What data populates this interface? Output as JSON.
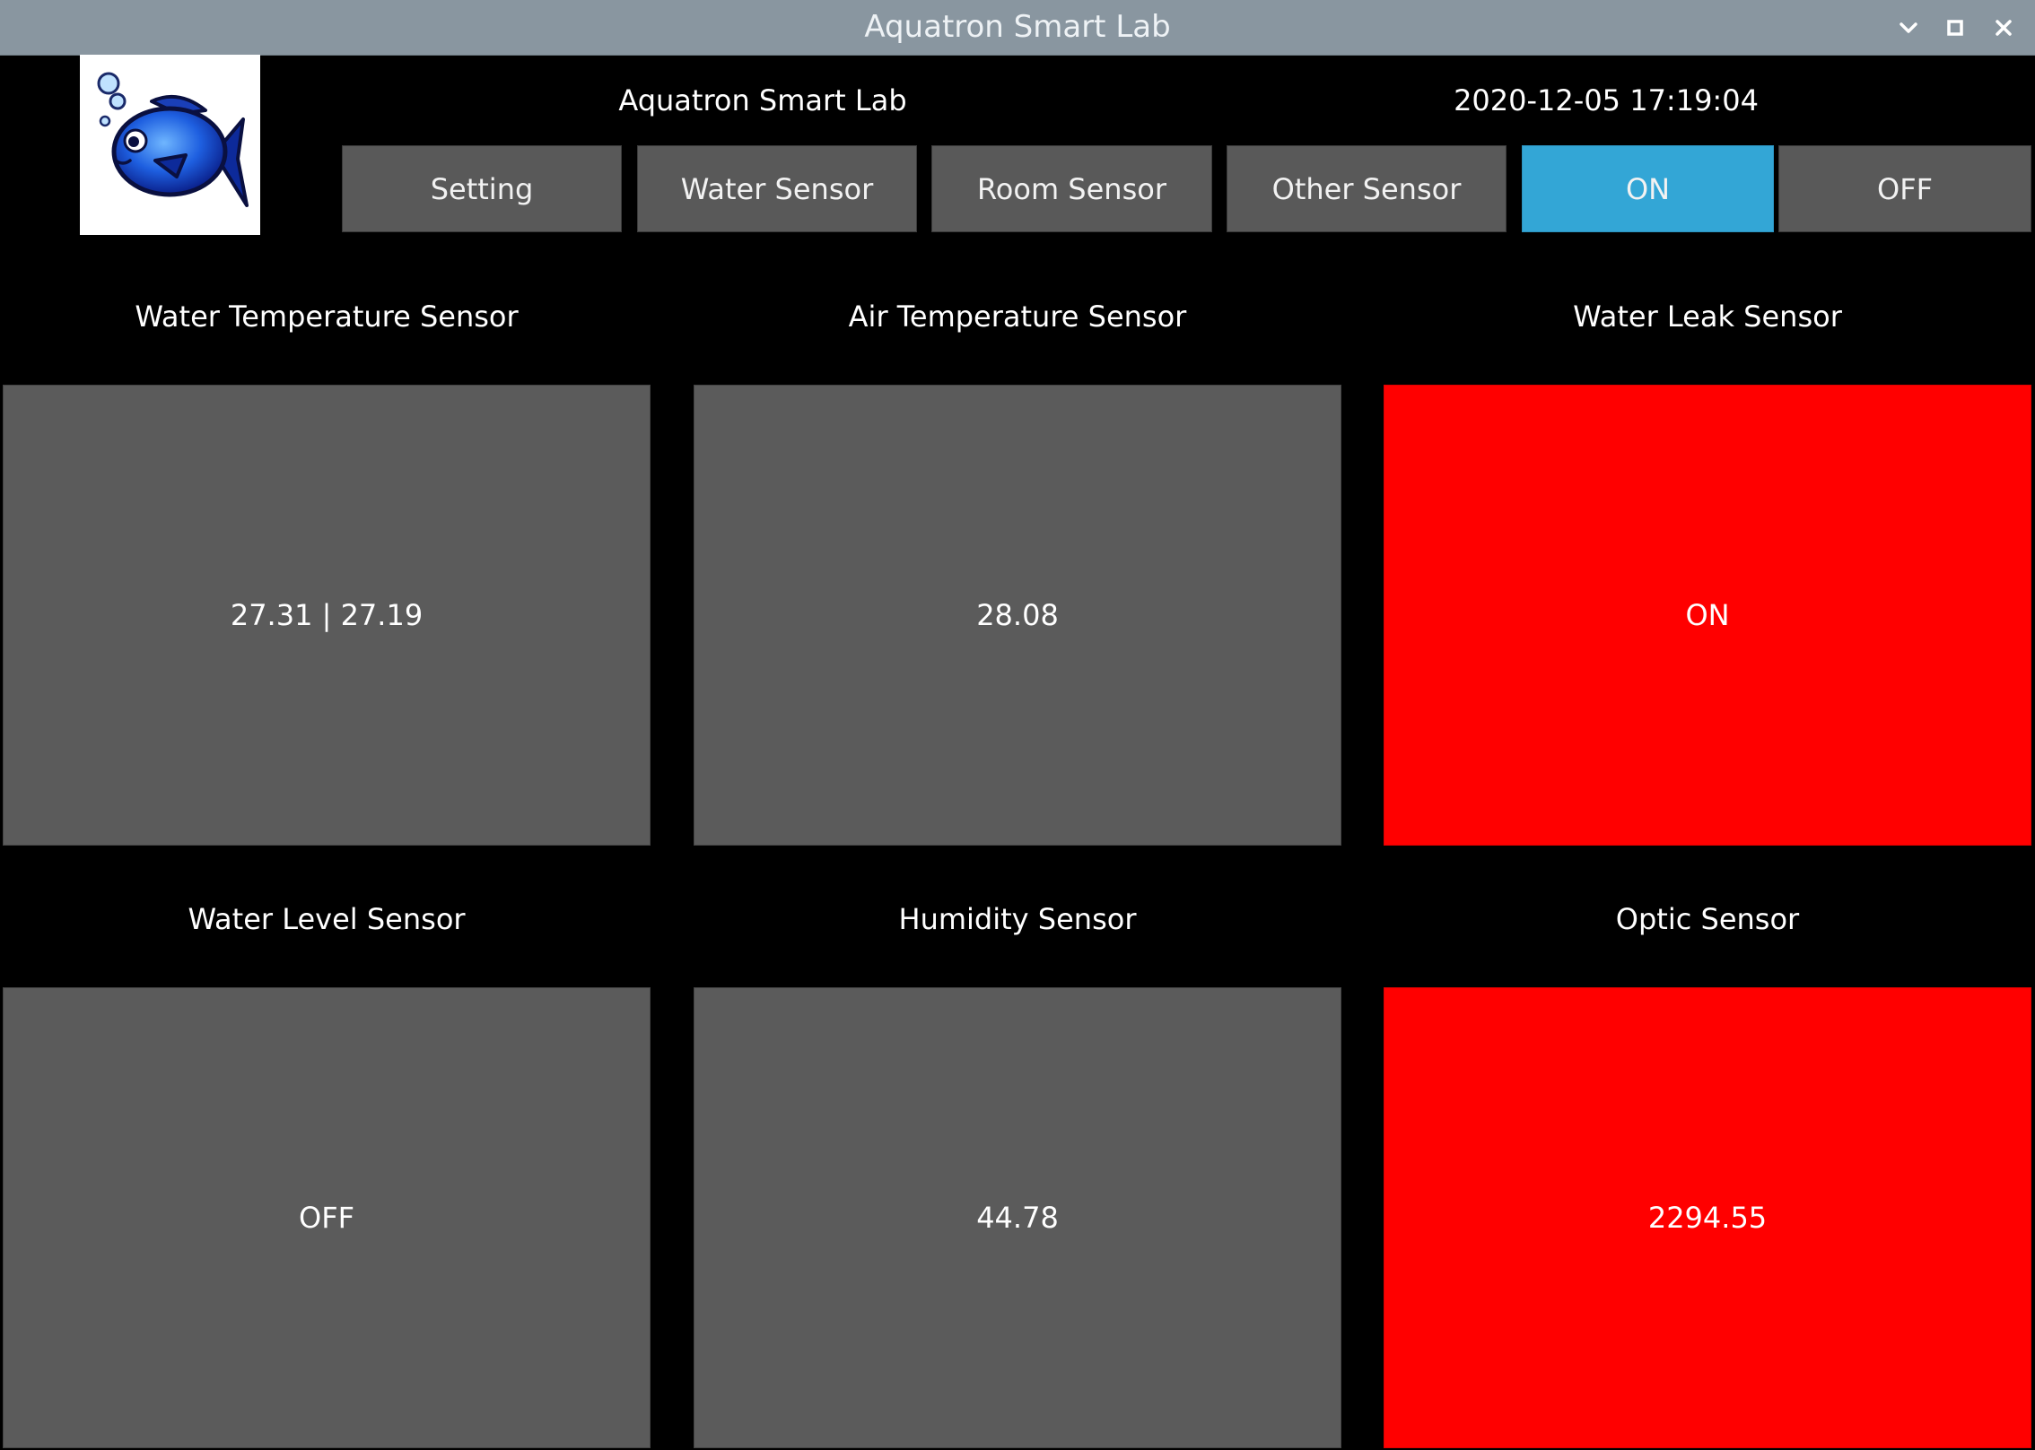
{
  "window": {
    "title": "Aquatron Smart Lab",
    "controls": [
      "chevron-down-icon",
      "maximize-icon",
      "close-icon"
    ]
  },
  "header": {
    "app_title": "Aquatron Smart Lab",
    "datetime": "2020-12-05 17:19:04",
    "logo_icon": "fish-logo-icon"
  },
  "nav": {
    "setting": "Setting",
    "water_sensor": "Water Sensor",
    "room_sensor": "Room Sensor",
    "other_sensor": "Other Sensor",
    "on": "ON",
    "off": "OFF",
    "active": "on"
  },
  "sensors": [
    {
      "label": "Water Temperature Sensor",
      "value": "27.31 | 27.19",
      "status": "normal"
    },
    {
      "label": "Air Temperature Sensor",
      "value": "28.08",
      "status": "normal"
    },
    {
      "label": "Water Leak Sensor",
      "value": "ON",
      "status": "alert"
    },
    {
      "label": "Water Level Sensor",
      "value": "OFF",
      "status": "normal"
    },
    {
      "label": "Humidity Sensor",
      "value": "44.78",
      "status": "normal"
    },
    {
      "label": "Optic Sensor",
      "value": "2294.55",
      "status": "alert"
    }
  ],
  "colors": {
    "titlebar": "#8996a0",
    "tile": "#5b5b5b",
    "alert": "#ff0000",
    "active_button": "#33a6d6",
    "background": "#000000"
  }
}
